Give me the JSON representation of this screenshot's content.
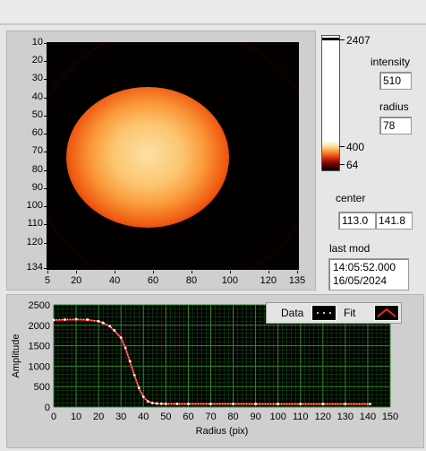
{
  "image_panel": {
    "y_ticks": [
      "10",
      "20",
      "30",
      "40",
      "50",
      "60",
      "70",
      "80",
      "90",
      "100",
      "110",
      "120",
      "134"
    ],
    "x_ticks": [
      "5",
      "20",
      "40",
      "60",
      "80",
      "100",
      "120",
      "135"
    ]
  },
  "colorbar": {
    "max_label": "2407",
    "mid_label": "400",
    "min_label": "64"
  },
  "intensity": {
    "label": "intensity",
    "value": "510"
  },
  "radius": {
    "label": "radius",
    "value": "78"
  },
  "center": {
    "label": "center",
    "x": "113.0",
    "y": "141.8"
  },
  "last_mod": {
    "label": "last mod",
    "time": "14:05:52.000",
    "date": "16/05/2024"
  },
  "legend": {
    "data_label": "Data",
    "fit_label": "Fit"
  },
  "colors": {
    "data": "#ffffff",
    "fit": "#ff2020",
    "grid": "#2e8b2e",
    "plot_bg": "#000000"
  },
  "chart_data": {
    "type": "scatter",
    "title": "",
    "xlabel": "Radius (pix)",
    "ylabel": "Amplitude",
    "xlim": [
      0,
      150
    ],
    "ylim": [
      0,
      2500
    ],
    "x_ticks": [
      0,
      10,
      20,
      30,
      40,
      50,
      60,
      70,
      80,
      90,
      100,
      110,
      120,
      130,
      140,
      150
    ],
    "y_ticks": [
      0,
      500,
      1000,
      1500,
      2000,
      2500
    ],
    "grid": true,
    "legend_position": "top-right",
    "series": [
      {
        "name": "Data",
        "style": "points",
        "x": [
          0,
          5,
          10,
          15,
          20,
          22,
          25,
          27,
          30,
          32,
          34,
          36,
          38,
          40,
          42,
          44,
          46,
          48,
          50,
          55,
          60,
          70,
          80,
          90,
          100,
          110,
          120,
          130,
          141
        ],
        "y": [
          2130,
          2140,
          2150,
          2140,
          2100,
          2060,
          1980,
          1880,
          1700,
          1450,
          1120,
          780,
          470,
          250,
          140,
          100,
          88,
          82,
          80,
          78,
          78,
          77,
          76,
          76,
          75,
          75,
          75,
          74,
          74
        ]
      },
      {
        "name": "Fit",
        "style": "line",
        "x": [
          0,
          5,
          10,
          15,
          20,
          22,
          25,
          27,
          30,
          32,
          34,
          36,
          38,
          40,
          42,
          44,
          46,
          48,
          50,
          55,
          60,
          70,
          80,
          90,
          100,
          110,
          120,
          130,
          141
        ],
        "y": [
          2125,
          2135,
          2140,
          2130,
          2095,
          2055,
          1975,
          1870,
          1690,
          1440,
          1110,
          770,
          460,
          245,
          135,
          98,
          86,
          80,
          78,
          77,
          77,
          76,
          76,
          75,
          75,
          75,
          74,
          74,
          74
        ]
      }
    ]
  }
}
